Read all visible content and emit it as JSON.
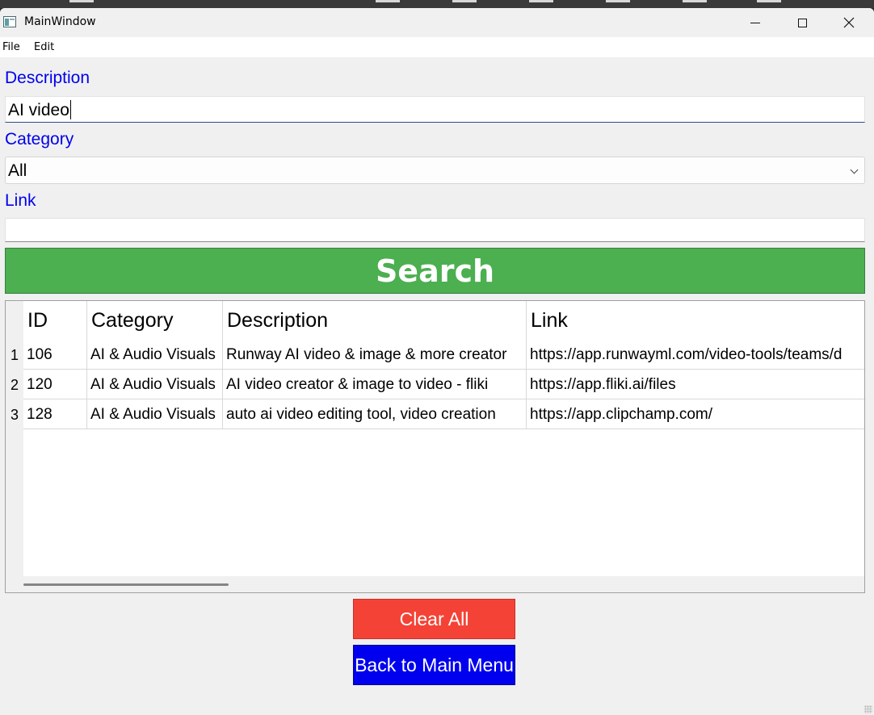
{
  "window": {
    "title": "MainWindow",
    "controls": [
      "minimize",
      "maximize",
      "close"
    ]
  },
  "menu": {
    "items": [
      "File",
      "Edit"
    ]
  },
  "form": {
    "description_label": "Description",
    "description_value": "AI video",
    "category_label": "Category",
    "category_value": "All",
    "link_label": "Link",
    "link_value": ""
  },
  "search_button": {
    "label": "Search",
    "color": "#4caf50"
  },
  "table": {
    "columns": [
      "ID",
      "Category",
      "Description",
      "Link"
    ],
    "rows": [
      {
        "num": "1",
        "id": "106",
        "category": "AI & Audio Visuals",
        "description": "Runway AI video & image & more creator",
        "link": "https://app.runwayml.com/video-tools/teams/d"
      },
      {
        "num": "2",
        "id": "120",
        "category": "AI & Audio Visuals",
        "description": "AI video creator & image to video - fliki",
        "link": "https://app.fliki.ai/files"
      },
      {
        "num": "3",
        "id": "128",
        "category": "AI & Audio Visuals",
        "description": "auto ai video editing tool, video creation",
        "link": "https://app.clipchamp.com/"
      }
    ]
  },
  "buttons": {
    "clear_label": "Clear All",
    "clear_color": "#f44336",
    "back_label": "Back to Main Menu",
    "back_color": "#0000ee"
  },
  "colors": {
    "label_color": "#0000ee"
  }
}
